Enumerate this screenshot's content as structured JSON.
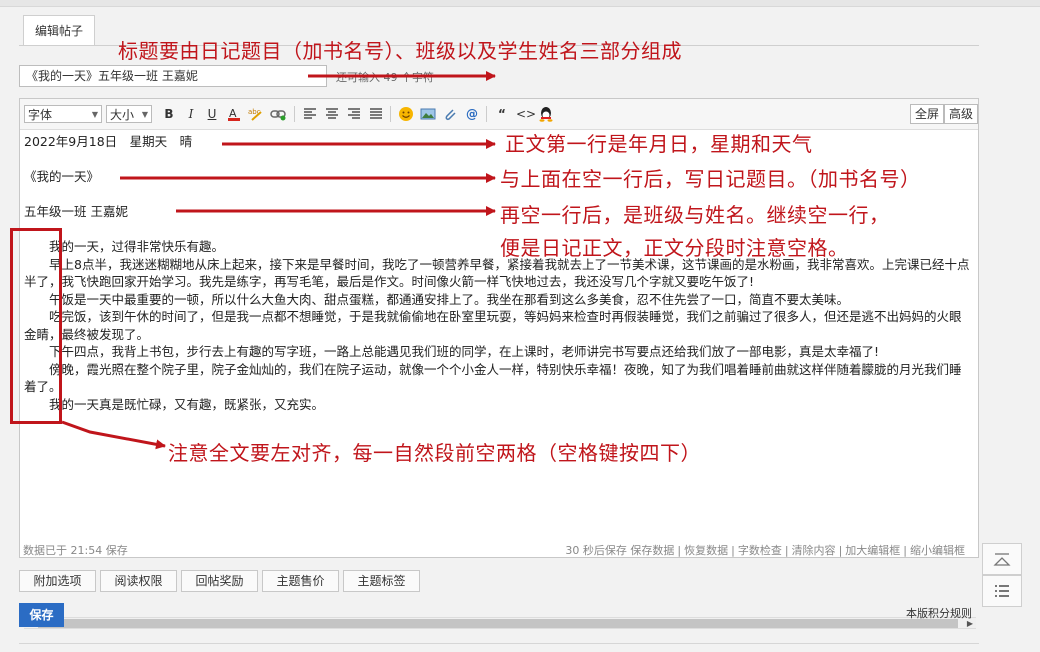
{
  "tab": {
    "label": "编辑帖子"
  },
  "title_input": {
    "value": "《我的一天》五年级一班 王嘉妮",
    "hint": "还可输入 49 个字符"
  },
  "toolbar": {
    "font_family": "字体",
    "font_size": "大小",
    "bold": "B",
    "italic": "I",
    "underline": "U",
    "fullscreen": "全屏",
    "advanced": "高级",
    "icons": [
      "bold-icon",
      "italic-icon",
      "underline-icon",
      "font-color-icon",
      "spellcheck-icon",
      "link-icon",
      "align-left-icon",
      "align-center-icon",
      "align-right-icon",
      "align-justify-icon",
      "emoji-icon",
      "image-icon",
      "attach-icon",
      "at-icon",
      "quote-icon",
      "code-icon",
      "qq-icon"
    ]
  },
  "content": {
    "line1": "2022年9月18日　星期天　晴",
    "line2": "《我的一天》",
    "line3": "五年级一班  王嘉妮",
    "paragraphs": [
      "　　我的一天，过得非常快乐有趣。",
      "　　早上8点半，我迷迷糊糊地从床上起来，接下来是早餐时间，我吃了一顿营养早餐，紧接着我就去上了一节美术课，这节课画的是水粉画，我非常喜欢。上完课已经十点半了，我飞快跑回家开始学习。我先是练字，再写毛笔，最后是作文。时间像火箭一样飞快地过去，我还没写几个字就又要吃午饭了!",
      "　　午饭是一天中最重要的一顿，所以什么大鱼大肉、甜点蛋糕，都通通安排上了。我坐在那看到这么多美食，忍不住先尝了一口，简直不要太美味。",
      "　　吃完饭，该到午休的时间了，但是我一点都不想睡觉，于是我就偷偷地在卧室里玩耍，等妈妈来检查时再假装睡觉，我们之前骗过了很多人，但还是逃不出妈妈的火眼金睛，最终被发现了。",
      "　　下午四点，我背上书包，步行去上有趣的写字班，一路上总能遇见我们班的同学，在上课时，老师讲完书写要点还给我们放了一部电影，真是太幸福了!",
      "　　傍晚，霞光照在整个院子里，院子金灿灿的，我们在院子运动，就像一个个小金人一样，特别快乐幸福！夜晚，知了为我们唱着睡前曲就这样伴随着朦胧的月光我们睡着了。",
      "　　我的一天真是既忙碌，又有趣，既紧张，又充实。"
    ]
  },
  "status": {
    "saved": "数据已于 21:54 保存",
    "actions": [
      "30 秒后保存 保存数据",
      "恢复数据",
      "字数检查",
      "清除内容",
      "加大编辑框",
      "缩小编辑框"
    ]
  },
  "options": [
    "附加选项",
    "阅读权限",
    "回帖奖励",
    "主题售价",
    "主题标签"
  ],
  "save_label": "保存",
  "rules_link": "本版积分规则",
  "annotations": {
    "a1": "标题要由日记题目（加书名号）、班级以及学生姓名三部分组成",
    "a2": "正文第一行是年月日，星期和天气",
    "a3": "与上面在空一行后，写日记题目。（加书名号）",
    "a4": "再空一行后，是班级与姓名。继续空一行，",
    "a5": "便是日记正文，正文分段时注意空格。",
    "a6": "注意全文要左对齐，每一自然段前空两格（空格键按四下）"
  },
  "colors": {
    "annotation": "#c0151b",
    "save_button": "#2b6cc4"
  }
}
